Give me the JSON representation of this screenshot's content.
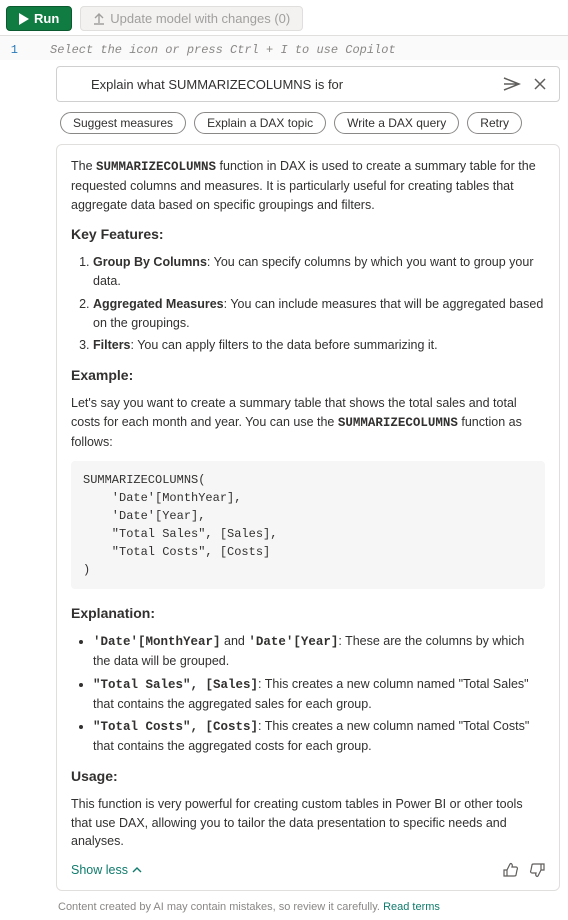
{
  "toolbar": {
    "run_label": "Run",
    "update_label": "Update model with changes (0)"
  },
  "editor": {
    "line_number": "1",
    "placeholder": "Select the icon or press Ctrl + I to use Copilot"
  },
  "panel": {
    "input_value": "Explain what SUMMARIZECOLUMNS is for",
    "chips": [
      "Suggest measures",
      "Explain a DAX topic",
      "Write a DAX query",
      "Retry"
    ]
  },
  "response": {
    "intro_pre": "The ",
    "intro_fn": "SUMMARIZECOLUMNS",
    "intro_post": " function in DAX is used to create a summary table for the requested columns and measures. It is particularly useful for creating tables that aggregate data based on specific groupings and filters.",
    "key_features_heading": "Key Features:",
    "features": [
      {
        "b": "Group By Columns",
        "t": ": You can specify columns by which you want to group your data."
      },
      {
        "b": "Aggregated Measures",
        "t": ": You can include measures that will be aggregated based on the groupings."
      },
      {
        "b": "Filters",
        "t": ": You can apply filters to the data before summarizing it."
      }
    ],
    "example_heading": "Example:",
    "example_intro_pre": "Let's say you want to create a summary table that shows the total sales and total costs for each month and year. You can use the ",
    "example_intro_fn": "SUMMARIZECOLUMNS",
    "example_intro_post": " function as follows:",
    "code": "SUMMARIZECOLUMNS(\n    'Date'[MonthYear],\n    'Date'[Year],\n    \"Total Sales\", [Sales],\n    \"Total Costs\", [Costs]\n)",
    "explanation_heading": "Explanation:",
    "explain": [
      {
        "c1": "'Date'[MonthYear]",
        "mid": " and ",
        "c2": "'Date'[Year]",
        "t": ": These are the columns by which the data will be grouped."
      },
      {
        "c1": "\"Total Sales\", [Sales]",
        "mid": "",
        "c2": "",
        "t": ": This creates a new column named \"Total Sales\" that contains the aggregated sales for each group."
      },
      {
        "c1": "\"Total Costs\", [Costs]",
        "mid": "",
        "c2": "",
        "t": ": This creates a new column named \"Total Costs\" that contains the aggregated costs for each group."
      }
    ],
    "usage_heading": "Usage:",
    "usage_text": "This function is very powerful for creating custom tables in Power BI or other tools that use DAX, allowing you to tailor the data presentation to specific needs and analyses.",
    "show_less": "Show less"
  },
  "disclaimer": {
    "text": "Content created by AI may contain mistakes, so review it carefully. ",
    "link": "Read terms"
  }
}
